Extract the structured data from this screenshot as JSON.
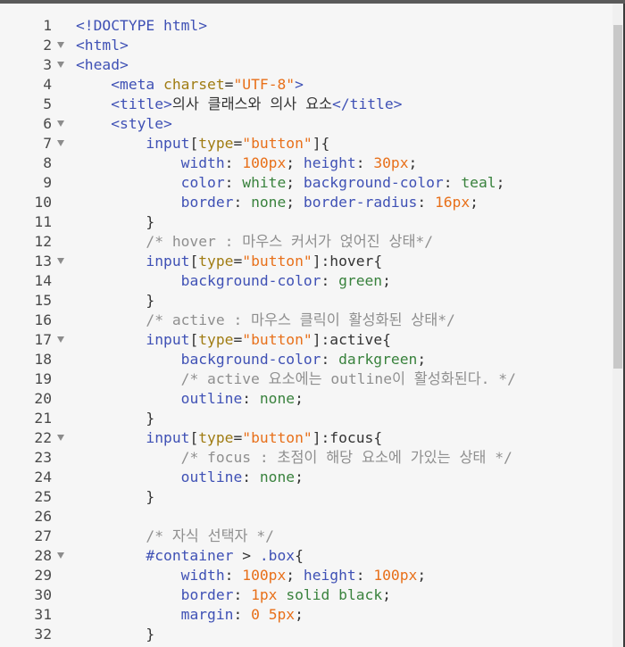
{
  "editor": {
    "lines": [
      {
        "n": "1",
        "fold": false,
        "tokens": [
          [
            "tag",
            "<!DOCTYPE html>"
          ]
        ]
      },
      {
        "n": "2",
        "fold": true,
        "tokens": [
          [
            "tag",
            "<html>"
          ]
        ]
      },
      {
        "n": "3",
        "fold": true,
        "tokens": [
          [
            "tag",
            "<head>"
          ]
        ]
      },
      {
        "n": "4",
        "fold": false,
        "tokens": [
          [
            "txt",
            "    "
          ],
          [
            "tag",
            "<meta "
          ],
          [
            "attr",
            "charset"
          ],
          [
            "txt",
            "="
          ],
          [
            "str",
            "\"UTF-8\""
          ],
          [
            "tag",
            ">"
          ]
        ]
      },
      {
        "n": "5",
        "fold": false,
        "tokens": [
          [
            "txt",
            "    "
          ],
          [
            "tag",
            "<title>"
          ],
          [
            "txt",
            "의사 클래스와 의사 요소"
          ],
          [
            "tag",
            "</title>"
          ]
        ]
      },
      {
        "n": "6",
        "fold": true,
        "tokens": [
          [
            "txt",
            "    "
          ],
          [
            "tag",
            "<style>"
          ]
        ]
      },
      {
        "n": "7",
        "fold": true,
        "tokens": [
          [
            "txt",
            "        "
          ],
          [
            "sel",
            "input"
          ],
          [
            "txt",
            "["
          ],
          [
            "attr",
            "type"
          ],
          [
            "txt",
            "="
          ],
          [
            "str",
            "\"button\""
          ],
          [
            "txt",
            "]{"
          ]
        ]
      },
      {
        "n": "8",
        "fold": false,
        "tokens": [
          [
            "txt",
            "            "
          ],
          [
            "prop",
            "width"
          ],
          [
            "txt",
            ": "
          ],
          [
            "num",
            "100px"
          ],
          [
            "txt",
            "; "
          ],
          [
            "prop",
            "height"
          ],
          [
            "txt",
            ": "
          ],
          [
            "num",
            "30px"
          ],
          [
            "txt",
            ";"
          ]
        ]
      },
      {
        "n": "9",
        "fold": false,
        "tokens": [
          [
            "txt",
            "            "
          ],
          [
            "prop",
            "color"
          ],
          [
            "txt",
            ": "
          ],
          [
            "val",
            "white"
          ],
          [
            "txt",
            "; "
          ],
          [
            "prop",
            "background-color"
          ],
          [
            "txt",
            ": "
          ],
          [
            "val",
            "teal"
          ],
          [
            "txt",
            ";"
          ]
        ]
      },
      {
        "n": "10",
        "fold": false,
        "tokens": [
          [
            "txt",
            "            "
          ],
          [
            "prop",
            "border"
          ],
          [
            "txt",
            ": "
          ],
          [
            "val",
            "none"
          ],
          [
            "txt",
            "; "
          ],
          [
            "prop",
            "border-radius"
          ],
          [
            "txt",
            ": "
          ],
          [
            "num",
            "16px"
          ],
          [
            "txt",
            ";"
          ]
        ]
      },
      {
        "n": "11",
        "fold": false,
        "tokens": [
          [
            "txt",
            "        }"
          ]
        ]
      },
      {
        "n": "12",
        "fold": false,
        "tokens": [
          [
            "txt",
            "        "
          ],
          [
            "cmt",
            "/* hover : 마우스 커서가 얹어진 상태*/"
          ]
        ]
      },
      {
        "n": "13",
        "fold": true,
        "tokens": [
          [
            "txt",
            "        "
          ],
          [
            "sel",
            "input"
          ],
          [
            "txt",
            "["
          ],
          [
            "attr",
            "type"
          ],
          [
            "txt",
            "="
          ],
          [
            "str",
            "\"button\""
          ],
          [
            "txt",
            "]:hover{"
          ]
        ]
      },
      {
        "n": "14",
        "fold": false,
        "tokens": [
          [
            "txt",
            "            "
          ],
          [
            "prop",
            "background-color"
          ],
          [
            "txt",
            ": "
          ],
          [
            "val",
            "green"
          ],
          [
            "txt",
            ";"
          ]
        ]
      },
      {
        "n": "15",
        "fold": false,
        "tokens": [
          [
            "txt",
            "        }"
          ]
        ]
      },
      {
        "n": "16",
        "fold": false,
        "tokens": [
          [
            "txt",
            "        "
          ],
          [
            "cmt",
            "/* active : 마우스 클릭이 활성화된 상태*/"
          ]
        ]
      },
      {
        "n": "17",
        "fold": true,
        "tokens": [
          [
            "txt",
            "        "
          ],
          [
            "sel",
            "input"
          ],
          [
            "txt",
            "["
          ],
          [
            "attr",
            "type"
          ],
          [
            "txt",
            "="
          ],
          [
            "str",
            "\"button\""
          ],
          [
            "txt",
            "]:active{"
          ]
        ]
      },
      {
        "n": "18",
        "fold": false,
        "tokens": [
          [
            "txt",
            "            "
          ],
          [
            "prop",
            "background-color"
          ],
          [
            "txt",
            ": "
          ],
          [
            "val",
            "darkgreen"
          ],
          [
            "txt",
            ";"
          ]
        ]
      },
      {
        "n": "19",
        "fold": false,
        "tokens": [
          [
            "txt",
            "            "
          ],
          [
            "cmt",
            "/* active 요소에는 outline이 활성화된다. */"
          ]
        ]
      },
      {
        "n": "20",
        "fold": false,
        "tokens": [
          [
            "txt",
            "            "
          ],
          [
            "prop",
            "outline"
          ],
          [
            "txt",
            ": "
          ],
          [
            "val",
            "none"
          ],
          [
            "txt",
            ";"
          ]
        ]
      },
      {
        "n": "21",
        "fold": false,
        "tokens": [
          [
            "txt",
            "        }"
          ]
        ]
      },
      {
        "n": "22",
        "fold": true,
        "tokens": [
          [
            "txt",
            "        "
          ],
          [
            "sel",
            "input"
          ],
          [
            "txt",
            "["
          ],
          [
            "attr",
            "type"
          ],
          [
            "txt",
            "="
          ],
          [
            "str",
            "\"button\""
          ],
          [
            "txt",
            "]:focus{"
          ]
        ]
      },
      {
        "n": "23",
        "fold": false,
        "tokens": [
          [
            "txt",
            "            "
          ],
          [
            "cmt",
            "/* focus : 초점이 해당 요소에 가있는 상태 */"
          ]
        ]
      },
      {
        "n": "24",
        "fold": false,
        "tokens": [
          [
            "txt",
            "            "
          ],
          [
            "prop",
            "outline"
          ],
          [
            "txt",
            ": "
          ],
          [
            "val",
            "none"
          ],
          [
            "txt",
            ";"
          ]
        ]
      },
      {
        "n": "25",
        "fold": false,
        "tokens": [
          [
            "txt",
            "        }"
          ]
        ]
      },
      {
        "n": "26",
        "fold": false,
        "tokens": []
      },
      {
        "n": "27",
        "fold": false,
        "tokens": [
          [
            "txt",
            "        "
          ],
          [
            "cmt",
            "/* 자식 선택자 */"
          ]
        ]
      },
      {
        "n": "28",
        "fold": true,
        "tokens": [
          [
            "txt",
            "        "
          ],
          [
            "sel",
            "#container"
          ],
          [
            "txt",
            " > "
          ],
          [
            "sel",
            ".box"
          ],
          [
            "txt",
            "{"
          ]
        ]
      },
      {
        "n": "29",
        "fold": false,
        "tokens": [
          [
            "txt",
            "            "
          ],
          [
            "prop",
            "width"
          ],
          [
            "txt",
            ": "
          ],
          [
            "num",
            "100px"
          ],
          [
            "txt",
            "; "
          ],
          [
            "prop",
            "height"
          ],
          [
            "txt",
            ": "
          ],
          [
            "num",
            "100px"
          ],
          [
            "txt",
            ";"
          ]
        ]
      },
      {
        "n": "30",
        "fold": false,
        "tokens": [
          [
            "txt",
            "            "
          ],
          [
            "prop",
            "border"
          ],
          [
            "txt",
            ": "
          ],
          [
            "num",
            "1px"
          ],
          [
            "txt",
            " "
          ],
          [
            "val",
            "solid"
          ],
          [
            "txt",
            " "
          ],
          [
            "val",
            "black"
          ],
          [
            "txt",
            ";"
          ]
        ]
      },
      {
        "n": "31",
        "fold": false,
        "tokens": [
          [
            "txt",
            "            "
          ],
          [
            "prop",
            "margin"
          ],
          [
            "txt",
            ": "
          ],
          [
            "num",
            "0"
          ],
          [
            "txt",
            " "
          ],
          [
            "num",
            "5px"
          ],
          [
            "txt",
            ";"
          ]
        ]
      },
      {
        "n": "32",
        "fold": false,
        "tokens": [
          [
            "txt",
            "        }"
          ]
        ]
      }
    ]
  },
  "colors": {
    "background": "#f6f6f6",
    "tag": "#3f51b5",
    "string": "#e8701a",
    "value": "#39823d",
    "comment": "#8f8f8f"
  }
}
